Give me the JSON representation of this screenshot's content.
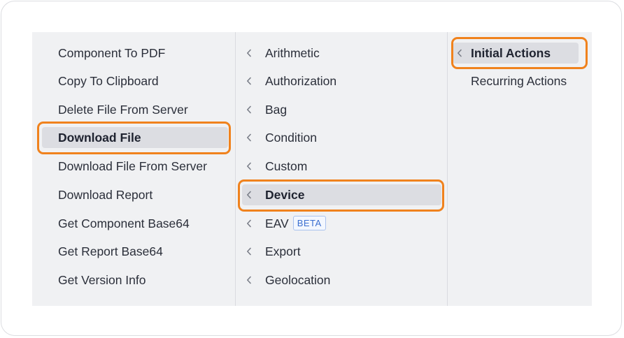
{
  "column1": {
    "items": [
      {
        "label": "Component To PDF"
      },
      {
        "label": "Copy To Clipboard"
      },
      {
        "label": "Delete File From Server"
      },
      {
        "label": "Download File",
        "active": true
      },
      {
        "label": "Download File From Server"
      },
      {
        "label": "Download Report"
      },
      {
        "label": "Get Component Base64"
      },
      {
        "label": "Get Report Base64"
      },
      {
        "label": "Get Version Info"
      }
    ]
  },
  "column2": {
    "items": [
      {
        "label": "Arithmetic",
        "icon": "chevron-left-icon"
      },
      {
        "label": "Authorization",
        "icon": "chevron-left-icon"
      },
      {
        "label": "Bag",
        "icon": "chevron-left-icon"
      },
      {
        "label": "Condition",
        "icon": "chevron-left-icon"
      },
      {
        "label": "Custom",
        "icon": "chevron-left-icon"
      },
      {
        "label": "Device",
        "icon": "chevron-left-icon",
        "active": true
      },
      {
        "label": "EAV",
        "icon": "chevron-left-icon",
        "badge": "BETA"
      },
      {
        "label": "Export",
        "icon": "chevron-left-icon"
      },
      {
        "label": "Geolocation",
        "icon": "chevron-left-icon"
      }
    ]
  },
  "column3": {
    "items": [
      {
        "label": "Initial Actions",
        "icon": "chevron-left-icon",
        "active": true
      },
      {
        "label": "Recurring Actions"
      }
    ]
  },
  "colors": {
    "highlight": "#f0821d",
    "menu_background": "#f0f1f3",
    "active_item": "#dcdde2",
    "badge_text": "#3b6fd0"
  }
}
